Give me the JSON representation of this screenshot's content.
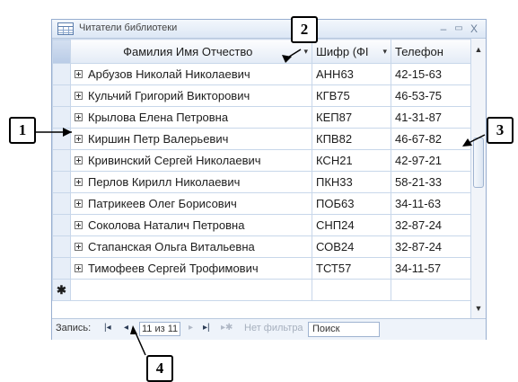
{
  "window": {
    "title": "Читатели библиотеки",
    "minimize_glyph": "–",
    "restore_glyph": "▭",
    "close_glyph": "X"
  },
  "grid": {
    "columns": [
      {
        "label": "Фамилия Имя Отчество",
        "dropdown": "▾"
      },
      {
        "label": "Шифр (ФІ",
        "dropdown": "▾"
      },
      {
        "label": "Телефон",
        "dropdown": ""
      }
    ],
    "rows": [
      {
        "name": "Арбузов Николай Николаевич",
        "code": "АНН63",
        "phone": "42-15-63"
      },
      {
        "name": "Кульчий Григорий Викторович",
        "code": "КГВ75",
        "phone": "46-53-75"
      },
      {
        "name": "Крылова Елена Петровна",
        "code": "КЕП87",
        "phone": "41-31-87"
      },
      {
        "name": "Киршин Петр Валерьевич",
        "code": "КПВ82",
        "phone": "46-67-82"
      },
      {
        "name": "Кривинский Сергей Николаевич",
        "code": "КСН21",
        "phone": "42-97-21"
      },
      {
        "name": "Перлов Кирилл Николаевич",
        "code": "ПКН33",
        "phone": "58-21-33"
      },
      {
        "name": "Патрикеев Олег Борисович",
        "code": "ПОБ63",
        "phone": "34-11-63"
      },
      {
        "name": "Соколова Наталич Петровна",
        "code": "СНП24",
        "phone": "32-87-24"
      },
      {
        "name": "Стапанская Ольга Витальевна",
        "code": "СОВ24",
        "phone": "32-87-24"
      },
      {
        "name": "Тимофеев Сергей Трофимович",
        "code": "ТСТ57",
        "phone": "34-11-57"
      }
    ],
    "new_row_marker": "✱"
  },
  "navbar": {
    "record_label": "Запись:",
    "first_btn": "|◂",
    "prev_btn": "◂",
    "counter": "11 из 11",
    "next_btn": "▸",
    "last_btn": "▸|",
    "new_btn": "▸✱",
    "filter_label": "Нет фильтра",
    "search_label": "Поиск"
  },
  "callouts": {
    "c1": "1",
    "c2": "2",
    "c3": "3",
    "c4": "4"
  }
}
